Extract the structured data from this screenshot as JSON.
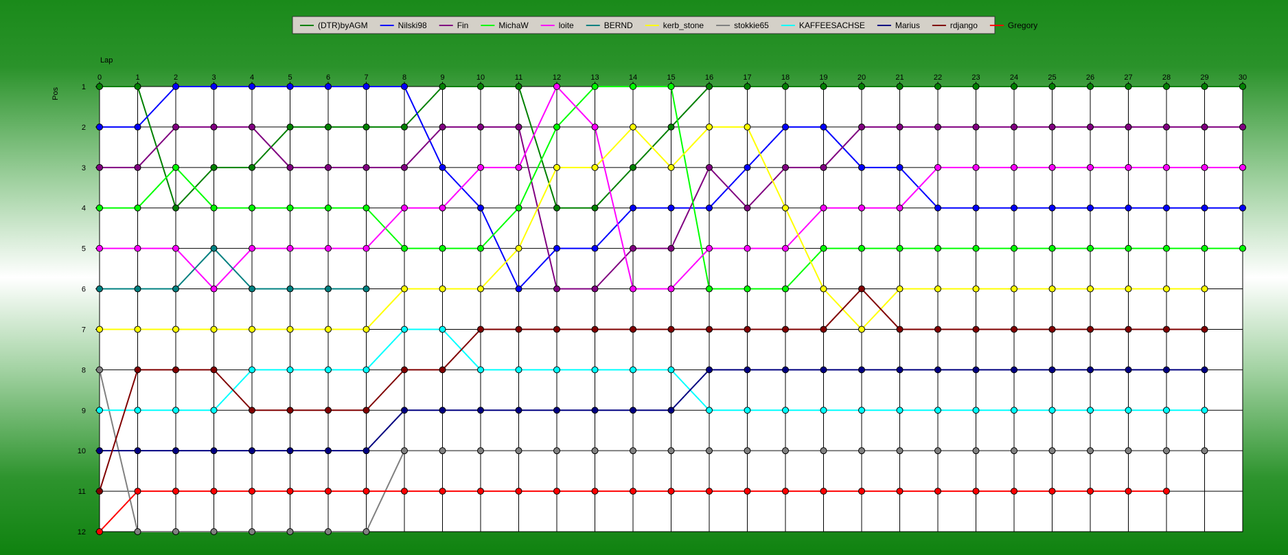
{
  "chart_data": {
    "type": "line",
    "xlabel": "Lap",
    "ylabel": "Pos",
    "xlim": [
      0,
      30
    ],
    "ylim": [
      1,
      12
    ],
    "y_inverted": true,
    "grid": true,
    "legend_position": "top-center",
    "x_ticks": [
      "0",
      "1",
      "2",
      "3",
      "4",
      "5",
      "6",
      "7",
      "8",
      "9",
      "10",
      "11",
      "12",
      "13",
      "14",
      "15",
      "16",
      "17",
      "18",
      "19",
      "20",
      "21",
      "22",
      "23",
      "24",
      "25",
      "26",
      "27",
      "28",
      "29",
      "30"
    ],
    "y_ticks": [
      "1",
      "2",
      "3",
      "4",
      "5",
      "6",
      "7",
      "8",
      "9",
      "10",
      "11",
      "12"
    ],
    "series": [
      {
        "name": "(DTR)byAGM",
        "color": "#008000",
        "values": [
          1,
          1,
          4,
          3,
          3,
          2,
          2,
          2,
          2,
          1,
          1,
          1,
          4,
          4,
          3,
          2,
          1,
          1,
          1,
          1,
          1,
          1,
          1,
          1,
          1,
          1,
          1,
          1,
          1,
          1,
          1
        ]
      },
      {
        "name": "Nilski98",
        "color": "#0000ff",
        "values": [
          2,
          2,
          1,
          1,
          1,
          1,
          1,
          1,
          1,
          3,
          4,
          6,
          5,
          5,
          4,
          4,
          4,
          3,
          2,
          2,
          3,
          3,
          4,
          4,
          4,
          4,
          4,
          4,
          4,
          4,
          4
        ]
      },
      {
        "name": "Fin",
        "color": "#800080",
        "values": [
          3,
          3,
          2,
          2,
          2,
          3,
          3,
          3,
          3,
          2,
          2,
          2,
          6,
          6,
          5,
          5,
          3,
          4,
          3,
          3,
          2,
          2,
          2,
          2,
          2,
          2,
          2,
          2,
          2,
          2,
          2
        ]
      },
      {
        "name": "MichaW",
        "color": "#00ff00",
        "values": [
          4,
          4,
          3,
          4,
          4,
          4,
          4,
          4,
          5,
          5,
          5,
          4,
          2,
          1,
          1,
          1,
          6,
          6,
          6,
          5,
          5,
          5,
          5,
          5,
          5,
          5,
          5,
          5,
          5,
          5,
          5
        ]
      },
      {
        "name": "loite",
        "color": "#ff00ff",
        "values": [
          5,
          5,
          5,
          6,
          5,
          5,
          5,
          5,
          4,
          4,
          3,
          3,
          1,
          2,
          6,
          6,
          5,
          5,
          5,
          4,
          4,
          4,
          3,
          3,
          3,
          3,
          3,
          3,
          3,
          3,
          3
        ]
      },
      {
        "name": "BERND",
        "color": "#008080",
        "values": [
          6,
          6,
          6,
          5,
          6,
          6,
          6,
          6
        ]
      },
      {
        "name": "kerb_stone",
        "color": "#ffff00",
        "values": [
          7,
          7,
          7,
          7,
          7,
          7,
          7,
          7,
          6,
          6,
          6,
          5,
          3,
          3,
          2,
          3,
          2,
          2,
          4,
          6,
          7,
          6,
          6,
          6,
          6,
          6,
          6,
          6,
          6,
          6
        ]
      },
      {
        "name": "stokkie65",
        "color": "#808080",
        "values": [
          8,
          12,
          12,
          12,
          12,
          12,
          12,
          12,
          10,
          10,
          10,
          10,
          10,
          10,
          10,
          10,
          10,
          10,
          10,
          10,
          10,
          10,
          10,
          10,
          10,
          10,
          10,
          10,
          10,
          10
        ]
      },
      {
        "name": "KAFFEESACHSE",
        "color": "#00ffff",
        "values": [
          9,
          9,
          9,
          9,
          8,
          8,
          8,
          8,
          7,
          7,
          8,
          8,
          8,
          8,
          8,
          8,
          9,
          9,
          9,
          9,
          9,
          9,
          9,
          9,
          9,
          9,
          9,
          9,
          9,
          9
        ]
      },
      {
        "name": "Marius",
        "color": "#000080",
        "values": [
          10,
          10,
          10,
          10,
          10,
          10,
          10,
          10,
          9,
          9,
          9,
          9,
          9,
          9,
          9,
          9,
          8,
          8,
          8,
          8,
          8,
          8,
          8,
          8,
          8,
          8,
          8,
          8,
          8,
          8
        ]
      },
      {
        "name": "rdjango",
        "color": "#800000",
        "values": [
          11,
          8,
          8,
          8,
          9,
          9,
          9,
          9,
          8,
          8,
          7,
          7,
          7,
          7,
          7,
          7,
          7,
          7,
          7,
          7,
          6,
          7,
          7,
          7,
          7,
          7,
          7,
          7,
          7,
          7
        ]
      },
      {
        "name": "Gregory",
        "color": "#ff0000",
        "values": [
          12,
          11,
          11,
          11,
          11,
          11,
          11,
          11,
          11,
          11,
          11,
          11,
          11,
          11,
          11,
          11,
          11,
          11,
          11,
          11,
          11,
          11,
          11,
          11,
          11,
          11,
          11,
          11,
          11
        ]
      }
    ]
  }
}
